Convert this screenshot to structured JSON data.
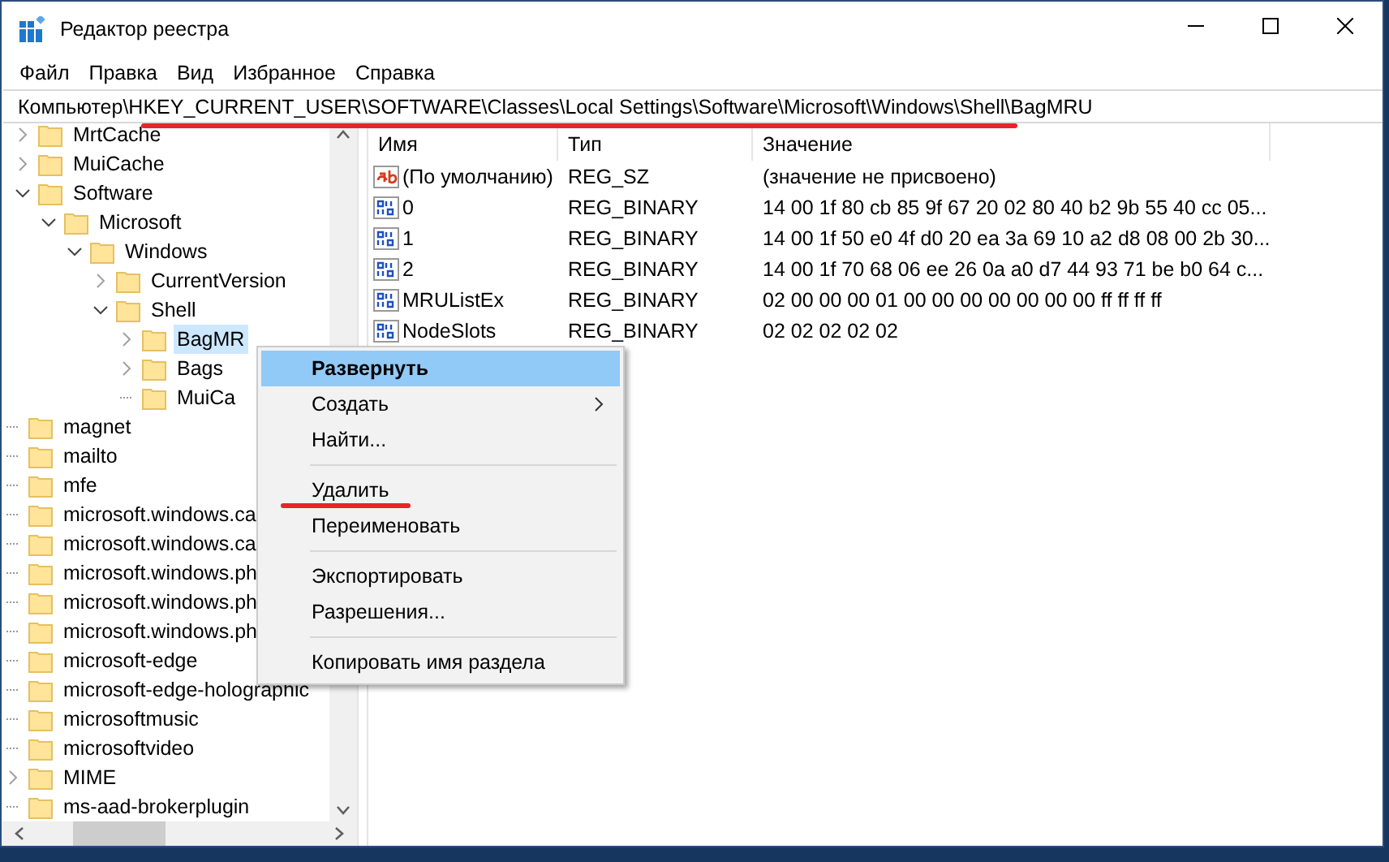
{
  "window": {
    "title": "Редактор реестра"
  },
  "menu_bar": [
    "Файл",
    "Правка",
    "Вид",
    "Избранное",
    "Справка"
  ],
  "address_bar": {
    "value": "Компьютер\\HKEY_CURRENT_USER\\SOFTWARE\\Classes\\Local Settings\\Software\\Microsoft\\Windows\\Shell\\BagMRU"
  },
  "tree": {
    "items": [
      {
        "children": [
          {
            "label": "MrtCache",
            "expanded": false,
            "selected": false
          },
          {
            "label": "MuiCache",
            "expanded": false,
            "selected": false
          },
          {
            "label": "Software",
            "expanded": true,
            "selected": false,
            "children": [
              {
                "label": "Microsoft",
                "expanded": true,
                "selected": false,
                "children": [
                  {
                    "label": "Windows",
                    "expanded": true,
                    "selected": false,
                    "children": [
                      {
                        "label": "CurrentVersion",
                        "expanded": false,
                        "selected": false
                      },
                      {
                        "label": "Shell",
                        "expanded": true,
                        "selected": false,
                        "children": [
                          {
                            "label": "BagMR",
                            "expanded": false,
                            "selected": true
                          },
                          {
                            "label": "Bags",
                            "expanded": false,
                            "selected": false
                          },
                          {
                            "label": "MuiCa",
                            "selected": false
                          }
                        ]
                      }
                    ]
                  }
                ]
              }
            ]
          }
        ]
      },
      {
        "label": "magnet",
        "selected": false
      },
      {
        "label": "mailto",
        "selected": false
      },
      {
        "label": "mfe",
        "selected": false
      },
      {
        "label": "microsoft.windows.ca",
        "selected": false
      },
      {
        "label": "microsoft.windows.ca",
        "selected": false
      },
      {
        "label": "microsoft.windows.ph",
        "selected": false
      },
      {
        "label": "microsoft.windows.ph",
        "selected": false
      },
      {
        "label": "microsoft.windows.ph",
        "selected": false
      },
      {
        "label": "microsoft-edge",
        "selected": false
      },
      {
        "label": "microsoft-edge-holographic",
        "selected": false
      },
      {
        "label": "microsoftmusic",
        "selected": false
      },
      {
        "label": "microsoftvideo",
        "selected": false
      },
      {
        "label": "MIME",
        "expanded": false,
        "selected": false
      },
      {
        "label": "ms-aad-brokerplugin",
        "selected": false
      }
    ]
  },
  "values": {
    "columns": [
      "Имя",
      "Тип",
      "Значение"
    ],
    "rows": [
      {
        "kind": "string",
        "name": "(По умолчанию)",
        "type": "REG_SZ",
        "value": "(значение не присвоено)"
      },
      {
        "kind": "binary",
        "name": "0",
        "type": "REG_BINARY",
        "value": "14 00 1f 80 cb 85 9f 67 20 02 80 40 b2 9b 55 40 cc 05..."
      },
      {
        "kind": "binary",
        "name": "1",
        "type": "REG_BINARY",
        "value": "14 00 1f 50 e0 4f d0 20 ea 3a 69 10 a2 d8 08 00 2b 30..."
      },
      {
        "kind": "binary",
        "name": "2",
        "type": "REG_BINARY",
        "value": "14 00 1f 70 68 06 ee 26 0a a0 d7 44 93 71 be b0 64 c..."
      },
      {
        "kind": "binary",
        "name": "MRUListEx",
        "type": "REG_BINARY",
        "value": "02 00 00 00 01 00 00 00 00 00 00 00 ff ff ff ff"
      },
      {
        "kind": "binary",
        "name": "NodeSlots",
        "type": "REG_BINARY",
        "value": "02 02 02 02 02"
      }
    ]
  },
  "context_menu": {
    "items": [
      {
        "kind": "item",
        "label": "Развернуть",
        "selected": true,
        "default": true,
        "submenu": false
      },
      {
        "kind": "item",
        "label": "Создать",
        "selected": false,
        "default": false,
        "submenu": true
      },
      {
        "kind": "item",
        "label": "Найти...",
        "selected": false,
        "default": false,
        "submenu": false
      },
      {
        "kind": "separator"
      },
      {
        "kind": "item",
        "label": "Удалить",
        "selected": false,
        "default": false,
        "submenu": false
      },
      {
        "kind": "item",
        "label": "Переименовать",
        "selected": false,
        "default": false,
        "submenu": false
      },
      {
        "kind": "separator"
      },
      {
        "kind": "item",
        "label": "Экспортировать",
        "selected": false,
        "default": false,
        "submenu": false
      },
      {
        "kind": "item",
        "label": "Разрешения...",
        "selected": false,
        "default": false,
        "submenu": false
      },
      {
        "kind": "separator"
      },
      {
        "kind": "item",
        "label": "Копировать имя раздела",
        "selected": false,
        "default": false,
        "submenu": false
      }
    ]
  }
}
